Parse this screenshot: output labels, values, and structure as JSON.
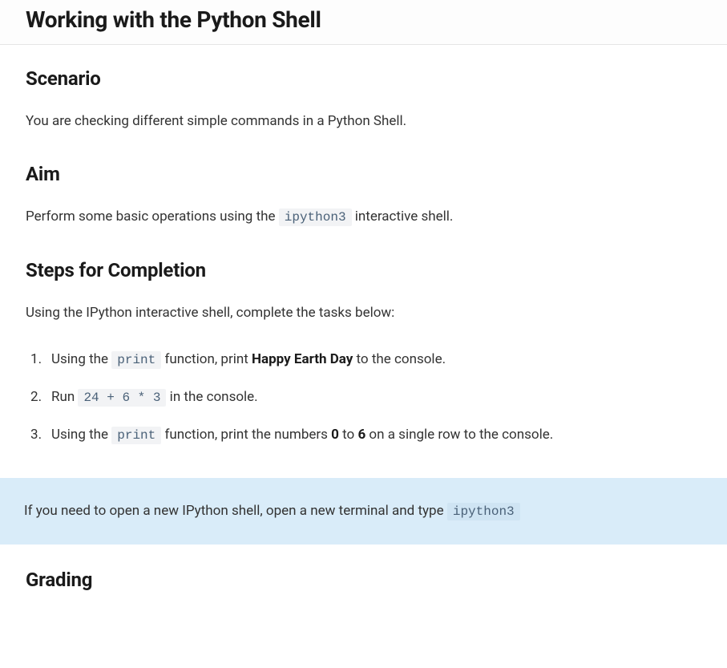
{
  "header": {
    "title": "Working with the Python Shell"
  },
  "scenario": {
    "heading": "Scenario",
    "text": "You are checking different simple commands in a Python Shell."
  },
  "aim": {
    "heading": "Aim",
    "text_before": "Perform some basic operations using the ",
    "code": "ipython3",
    "text_after": " interactive shell."
  },
  "steps": {
    "heading": "Steps for Completion",
    "intro": "Using the IPython interactive shell, complete the tasks below:",
    "items": [
      {
        "before_code": "Using the ",
        "code": "print",
        "after_code": " function, print ",
        "bold": "Happy Earth Day",
        "after_bold": " to the console."
      },
      {
        "before_code": "Run ",
        "code": "24 + 6 * 3",
        "after_code": " in the console."
      },
      {
        "before_code": "Using the ",
        "code": "print",
        "after_code": " function, print the numbers ",
        "bold": "0",
        "mid": " to ",
        "bold2": "6",
        "after_bold": " on a single row to the console."
      }
    ]
  },
  "note": {
    "before_code": "If you need to open a new IPython shell, open a new terminal and type ",
    "code": "ipython3"
  },
  "grading": {
    "heading": "Grading"
  }
}
